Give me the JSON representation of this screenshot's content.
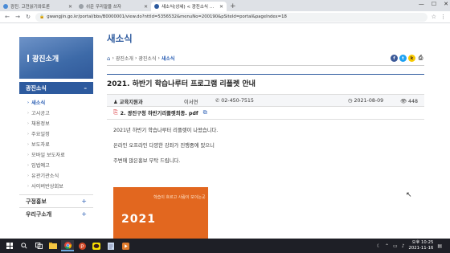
{
  "browser": {
    "tabs": [
      {
        "label": "광진. 고전읽기와토론",
        "favicon_color": "#4a8bd6",
        "active": false
      },
      {
        "label": "쉬운 우리말을 쓰자",
        "favicon_color": "#9aa0a6",
        "active": false
      },
      {
        "label": "새소식(상세) < 광진소식 < 광진",
        "favicon_color": "#2d5a9e",
        "active": true
      }
    ],
    "url": "gwangjin.go.kr/portal/bbs/B0000001/view.do?nttId=5356532&menuNo=200190&pSiteId=portal&pageIndex=18"
  },
  "sidebar": {
    "title": "광진소개",
    "current_section": "광진소식",
    "current_toggle": "–",
    "items": [
      {
        "label": "새소식",
        "active": true
      },
      {
        "label": "고시공고",
        "active": false
      },
      {
        "label": "채용정보",
        "active": false
      },
      {
        "label": "주요일정",
        "active": false
      },
      {
        "label": "보도자료",
        "active": false
      },
      {
        "label": "모바일 보도자료",
        "active": false
      },
      {
        "label": "입법예고",
        "active": false
      },
      {
        "label": "유관기관소식",
        "active": false
      },
      {
        "label": "사이버반상회보",
        "active": false
      }
    ],
    "other_sections": [
      {
        "label": "구정홍보",
        "toggle": "+"
      },
      {
        "label": "우리구소개",
        "toggle": "+"
      }
    ]
  },
  "main": {
    "page_title": "새소식",
    "breadcrumb": [
      "광진소개",
      "광진소식",
      "새소식"
    ],
    "post": {
      "title": "2021. 하반기 학습나루터 프로그램 리플렛 안내",
      "department": "교육지원과",
      "author": "이서연",
      "phone": "02-450-7515",
      "date": "2021-08-09",
      "views": "448",
      "attachment": "2. 광진구청 하반기리플렛최종. pdf",
      "body": [
        "2021년 하반기 학습나루터 리플렛이 나왔습니다.",
        "온라인 오프라인 다양한 강좌가 진행중에 있으니",
        "주변에 많은홍보 부탁 드립니다."
      ]
    },
    "poster": {
      "subtitle": "학습이 흐르고 사람이 모이는곳",
      "year": "2021"
    }
  },
  "taskbar": {
    "time_line1": "오후 10:25",
    "time_line2": "2021-11-16"
  },
  "colors": {
    "accent": "#2d5a9e",
    "poster_orange": "#e2671f",
    "taskbar": "#1e1f26"
  }
}
